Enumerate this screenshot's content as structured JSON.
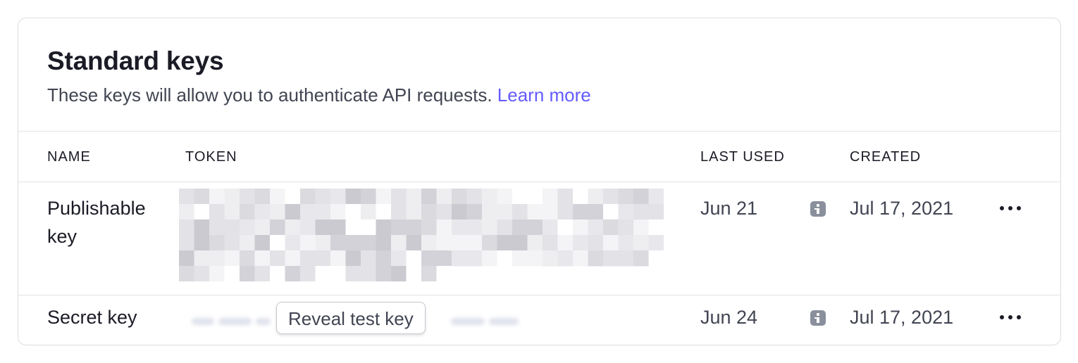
{
  "section": {
    "title": "Standard keys",
    "description": "These keys will allow you to authenticate API requests.",
    "learn_more": "Learn more"
  },
  "columns": {
    "name": "NAME",
    "token": "TOKEN",
    "last_used": "LAST USED",
    "created": "CREATED"
  },
  "rows": [
    {
      "name": "Publishable key",
      "token_state": "redacted (pixelated)",
      "last_used": "Jun 21",
      "created": "Jul 17, 2021"
    },
    {
      "name": "Secret key",
      "token_state": "hidden (blurred)",
      "reveal_label": "Reveal test key",
      "last_used": "Jun 24",
      "created": "Jul 17, 2021"
    }
  ],
  "icons": {
    "info": "info-icon",
    "more": "more-horizontal-icon"
  },
  "colors": {
    "link": "#635bff",
    "info_icon": "#8a8f9c",
    "border": "#dcdde3"
  }
}
